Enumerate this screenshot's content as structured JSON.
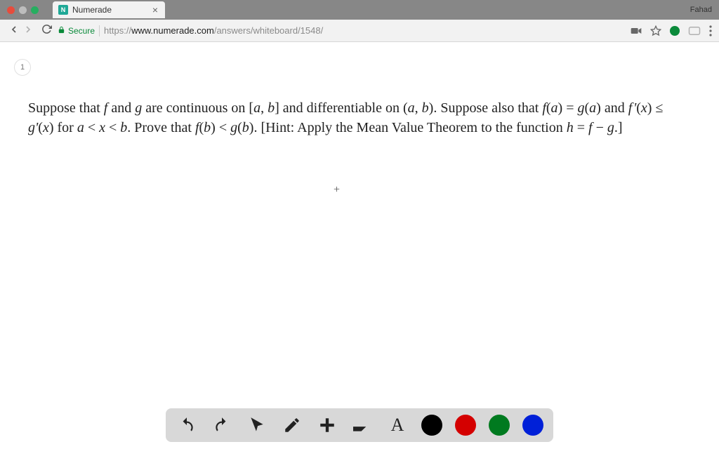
{
  "browser": {
    "tab_title": "Numerade",
    "favicon_letter": "N",
    "user_name": "Fahad",
    "secure_label": "Secure",
    "url_scheme": "https://",
    "url_host": "www.numerade.com",
    "url_path": "/answers/whiteboard/1548/"
  },
  "page": {
    "page_number": "1",
    "problem_html": "Suppose that <span class='math'>f</span> and <span class='math'>g</span> are continuous on [<span class='math'>a</span>, <span class='math'>b</span>] and differentiable on (<span class='math'>a</span>, <span class='math'>b</span>). Suppose also that <span class='math'>f</span>(<span class='math'>a</span>) = <span class='math'>g</span>(<span class='math'>a</span>) and <span class='math'>f&#8202;'</span>(<span class='math'>x</span>) &le; <span class='math'>g'</span>(<span class='math'>x</span>) for <span class='math'>a</span> &lt; <span class='math'>x</span> &lt; <span class='math'>b</span>. Prove that <span class='math'>f</span>(<span class='math'>b</span>) &lt; <span class='math'>g</span>(<span class='math'>b</span>). [Hint: Apply the Mean Value Theorem to the function <span class='math'>h</span> = <span class='math'>f</span> &minus; <span class='math'>g</span>.]"
  },
  "toolbar": {
    "colors": {
      "black": "#000000",
      "red": "#d40000",
      "green": "#007a1f",
      "blue": "#0020d8"
    }
  }
}
